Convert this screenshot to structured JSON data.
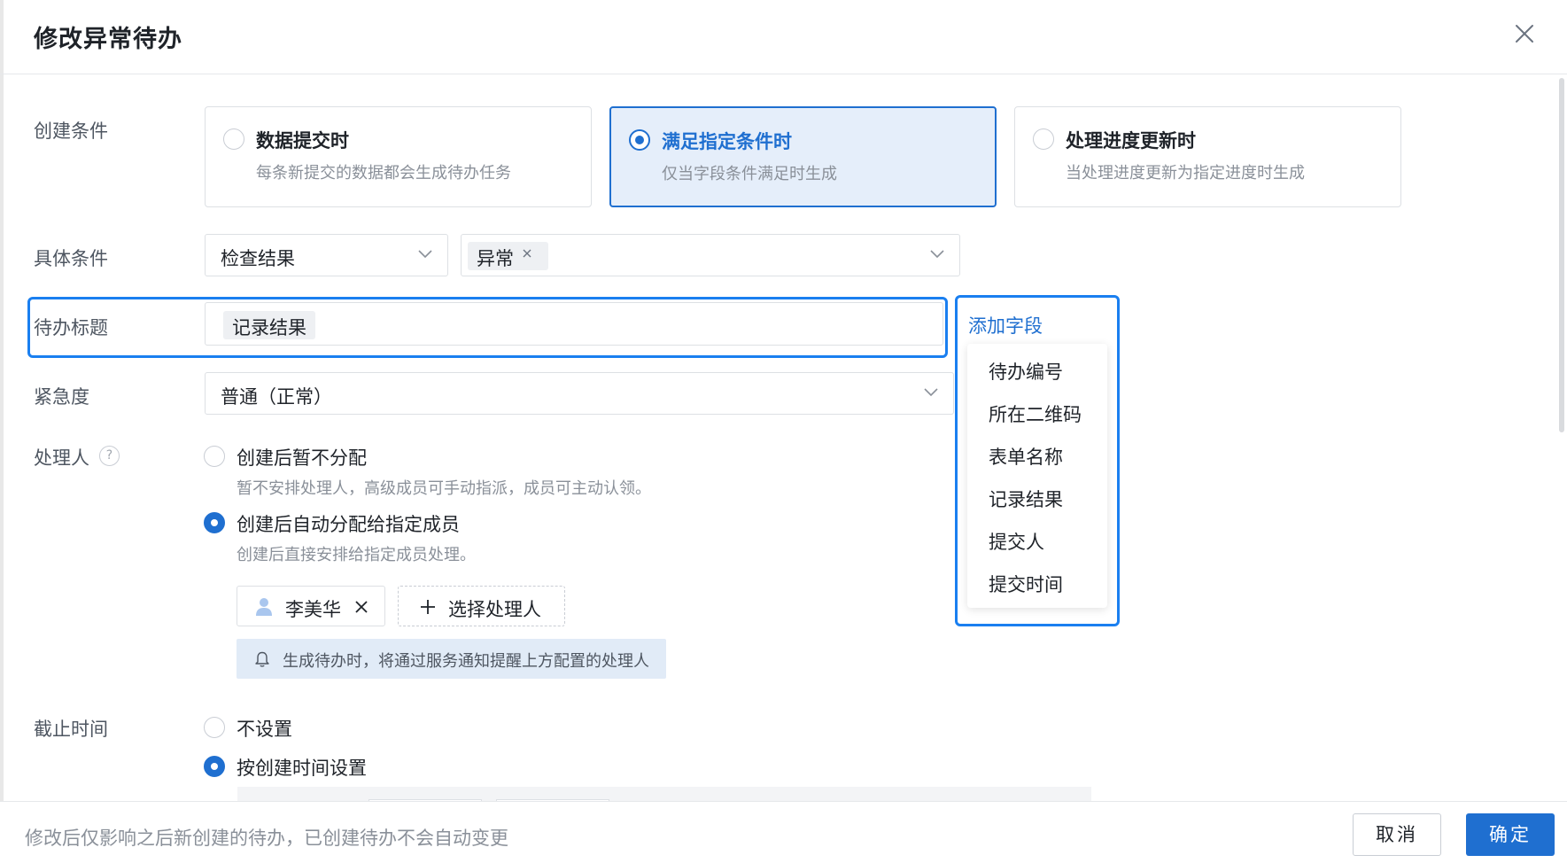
{
  "dialog": {
    "title": "修改异常待办"
  },
  "create_condition": {
    "label": "创建条件",
    "options": [
      {
        "title": "数据提交时",
        "desc": "每条新提交的数据都会生成待办任务",
        "selected": false
      },
      {
        "title": "满足指定条件时",
        "desc": "仅当字段条件满足时生成",
        "selected": true
      },
      {
        "title": "处理进度更新时",
        "desc": "当处理进度更新为指定进度时生成",
        "selected": false
      }
    ]
  },
  "specific_condition": {
    "label": "具体条件",
    "field": "检查结果",
    "value_tag": "异常"
  },
  "todo_title": {
    "label": "待办标题",
    "field_tag": "记录结果"
  },
  "add_field": {
    "label": "添加字段",
    "items": [
      "待办编号",
      "所在二维码",
      "表单名称",
      "记录结果",
      "提交人",
      "提交时间"
    ]
  },
  "urgency": {
    "label": "紧急度",
    "value": "普通（正常）"
  },
  "handler": {
    "label": "处理人",
    "help": "?",
    "options": [
      {
        "label": "创建后暂不分配",
        "hint": "暂不安排处理人，高级成员可手动指派，成员可主动认领。",
        "checked": false
      },
      {
        "label": "创建后自动分配给指定成员",
        "hint": "创建后直接安排给指定成员处理。",
        "checked": true
      }
    ],
    "assignee": "李美华",
    "pick_label": "选择处理人",
    "notice": "生成待办时，将通过服务通知提醒上方配置的处理人"
  },
  "deadline": {
    "label": "截止时间",
    "options": [
      {
        "label": "不设置",
        "checked": false
      },
      {
        "label": "按创建时间设置",
        "checked": true
      }
    ]
  },
  "footer": {
    "note": "修改后仅影响之后新创建的待办，已创建待办不会自动变更",
    "cancel": "取消",
    "confirm": "确定"
  },
  "colors": {
    "accent": "#1f6fd0",
    "highlight": "#1a7ff0",
    "selected_bg": "#e5eefa",
    "notice_bg": "#e1ebf7"
  }
}
